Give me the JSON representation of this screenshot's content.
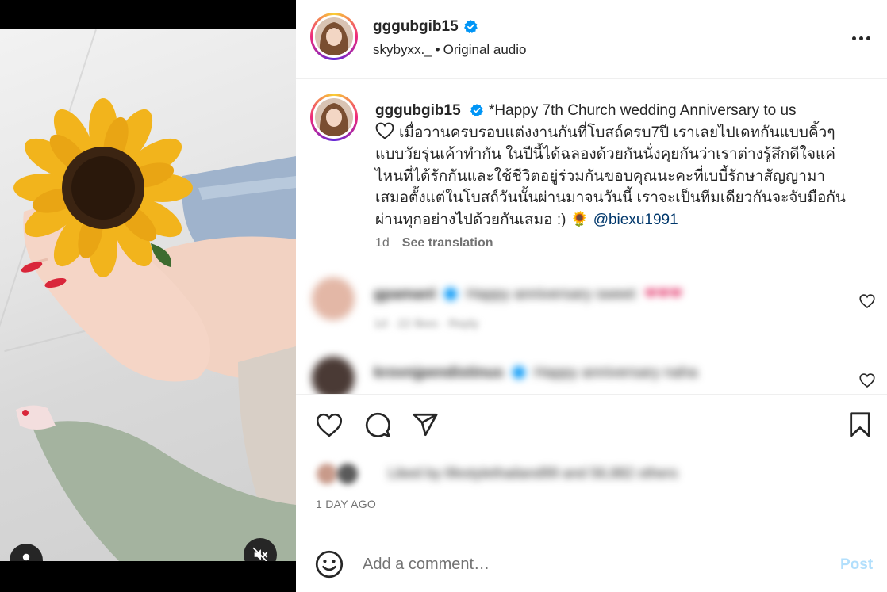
{
  "media": {
    "user_tag_icon": "person-icon",
    "mute_icon": "speaker-muted-icon"
  },
  "header": {
    "username": "gggubgib15",
    "verified": true,
    "audio_owner": "skybyxx._",
    "separator": "•",
    "audio_label": "Original audio",
    "more_icon": "more-horizontal-icon"
  },
  "caption": {
    "username": "gggubgib15",
    "text_line_1": "*Happy 7th Church wedding Anniversary to us",
    "heart_icon": "heart-outline-icon",
    "text_thai": "เมื่อวานครบรอบแต่งงานกันที่โบสถ์ครบ7ปี เราเลยไปเดทกันแบบคิ้วๆแบบวัยรุ่นเค้าทำกัน ในปีนี้ได้ฉลองด้วยกันนั่งคุยกันว่าเราต่างรู้สึกดีใจแค่ไหนที่ได้รักกันและใช้ชีวิตอยู่ร่วมกันขอบคุณนะคะที่เบบี้รักษาสัญญามาเสมอตั้งแต่ในโบสถ์วันนั้นผ่านมาจนวันนี้ เราจะเป็นทีมเดียวกันจะจับมือกันผ่านทุกอย่างไปด้วยกันเสมอ :)",
    "emoji": "🌻",
    "mention": "@biexu1991",
    "age": "1d",
    "see_translation": "See translation"
  },
  "comments": [
    {
      "username": "gpamanl",
      "text": "Happy anniversary sweet",
      "hearts": "❤❤❤",
      "meta": "1d · 22 likes · Reply",
      "avatar_color": "#e3b7a6"
    },
    {
      "username": "krovnjpendistinus",
      "text": "Happy anniversary naha",
      "hearts": "",
      "meta": "",
      "avatar_color": "#4a3a35"
    }
  ],
  "actions": {
    "like_icon": "heart-outline-icon",
    "comment_icon": "comment-bubble-icon",
    "share_icon": "paper-plane-icon",
    "save_icon": "bookmark-icon"
  },
  "likes": {
    "text": "Liked by lifestylethailand99 and 56,882 others"
  },
  "timestamp": "1 DAY AGO",
  "comment_bar": {
    "emoji_icon": "smiley-icon",
    "placeholder": "Add a comment…",
    "post_label": "Post"
  },
  "colors": {
    "accent_link": "#00376b",
    "verified_blue": "#0095f6",
    "post_disabled": "#b2dffc",
    "muted_text": "#737373"
  }
}
